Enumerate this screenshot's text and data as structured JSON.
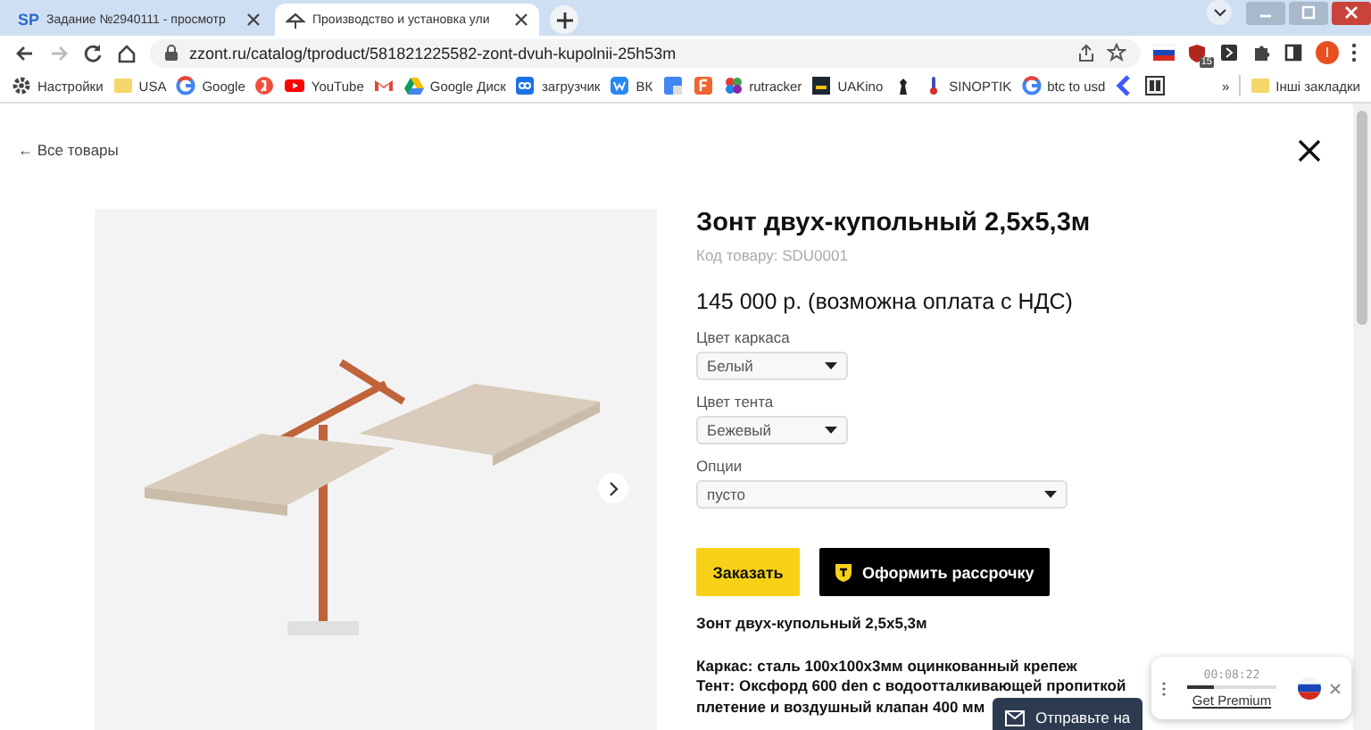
{
  "browser": {
    "tabs": [
      {
        "logo": "SP",
        "title": "Задание №2940111 - просмотр",
        "selected": false
      },
      {
        "title": "Производство и установка ули",
        "selected": true
      }
    ],
    "url": "zzont.ru/catalog/tproduct/581821225582-zont-dvuh-kupolnii-25h53m",
    "extension_badge": "15",
    "profile": "I",
    "bookmarks": [
      {
        "kind": "gear",
        "label": "Настройки"
      },
      {
        "kind": "folder",
        "label": "USA"
      },
      {
        "kind": "google",
        "label": "Google"
      },
      {
        "kind": "yandex"
      },
      {
        "kind": "youtube",
        "label": "YouTube"
      },
      {
        "kind": "gmail"
      },
      {
        "kind": "drive",
        "label": "Google Диск"
      },
      {
        "kind": "loader",
        "label": "загрузчик"
      },
      {
        "kind": "vk",
        "label": "ВК"
      },
      {
        "kind": "translate"
      },
      {
        "kind": "letter-f"
      },
      {
        "kind": "rutracker",
        "label": "rutracker"
      },
      {
        "kind": "uakino",
        "label": "UAKino"
      },
      {
        "kind": "chess"
      },
      {
        "kind": "thermometer",
        "label": "SINOPTIK"
      },
      {
        "kind": "google",
        "label": "btc to usd"
      },
      {
        "kind": "chevron"
      },
      {
        "kind": "dc"
      }
    ],
    "more": "»",
    "other_bookmarks": "Інші закладки"
  },
  "page": {
    "back_link": "← Все товары",
    "product": {
      "title": "Зонт двух-купольный 2,5х5,3м",
      "code": "Код товару: SDU0001",
      "price": "145 000 р. (возможна оплата с НДС)",
      "options": [
        {
          "label": "Цвет каркаса",
          "value": "Белый"
        },
        {
          "label": "Цвет тента",
          "value": "Бежевый"
        },
        {
          "label": "Опции",
          "value": "пусто"
        }
      ],
      "order_button": "Заказать",
      "installment_button": "Оформить рассрочку",
      "description_heading": "Зонт двух-купольный 2,5х5,3м",
      "description_lines": [
        "Каркас: сталь 100х100х3мм оцинкованный крепеж",
        "Тент: Оксфорд 600 den с водоотталкивающей пропиткой",
        "плетение и воздушный клапан 400 мм"
      ]
    }
  },
  "chat_button": "Отправьте на",
  "recorder": {
    "time": "00:08:22",
    "level": 0.3,
    "link": "Get Premium"
  }
}
